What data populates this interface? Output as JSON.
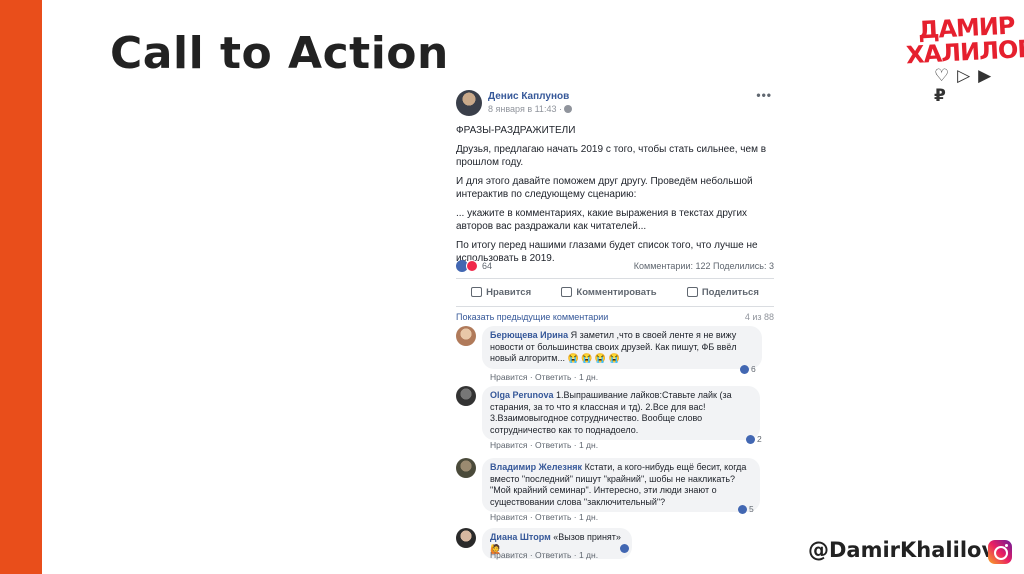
{
  "slide": {
    "title": "Call to Action",
    "logo_line1": "ДАМИР",
    "logo_line2": "ХАЛИЛОВ",
    "handle": "@DamirKhalilov"
  },
  "colors": {
    "accent": "#e94e1b",
    "logo_red": "#e5202e",
    "fb_blue": "#365899"
  },
  "post": {
    "author": "Денис Каплунов",
    "meta": "8 января в 11:43 ·",
    "paragraphs": [
      "ФРАЗЫ-РАЗДРАЖИТЕЛИ",
      "Друзья, предлагаю начать 2019 с того, чтобы стать сильнее, чем в прошлом году.",
      "И для этого давайте поможем друг другу. Проведём небольшой интерактив по следующему сценарию:",
      "... укажите в комментариях, какие выражения в текстах других авторов вас раздражали как читателей...",
      "По итогу перед нашими глазами будет список того, что лучше не использовать в 2019."
    ],
    "reactions_count": "64",
    "stats": "Комментарии: 122   Поделились: 3",
    "actions": {
      "like": "Нравится",
      "comment": "Комментировать",
      "share": "Поделиться"
    },
    "prev_comments": "Показать предыдущие комментарии",
    "prev_count": "4 из 88"
  },
  "comments": [
    {
      "author": "Берющева Ирина",
      "text": " Я заметил ,что в своей ленте я не вижу новости от большинства своих друзей. Как пишут, ФБ ввёл новый алгоритм... 😭 😭 😭 😭",
      "links": "Нравится · Ответить · 1 дн.",
      "reactions": "6"
    },
    {
      "author": "Olga Perunova",
      "text": " 1.Выпрашивание лайков:Ставьте лайк (за старания, за то что я классная и тд). 2.Все для вас! 3.Взаимовыгодное сотрудничество. Вообще слово сотрудничество как то поднадоело.",
      "links": "Нравится · Ответить · 1 дн.",
      "reactions": "2"
    },
    {
      "author": "Владимир Железняк",
      "text": " Кстати, а кого-нибудь ещё бесит, когда вместо \"последний\" пишут \"крайний\", шобы не накликать? \"Мой крайний семинар\". Интересно, эти люди знают о существовании слова \"заключительный\"?",
      "links": "Нравится · Ответить · 1 дн.",
      "reactions": "5"
    },
    {
      "author": "Диана Шторм",
      "text": " «Вызов принят» 🙋",
      "links": "Нравится · Ответить · 1 дн.",
      "reactions": ""
    }
  ]
}
